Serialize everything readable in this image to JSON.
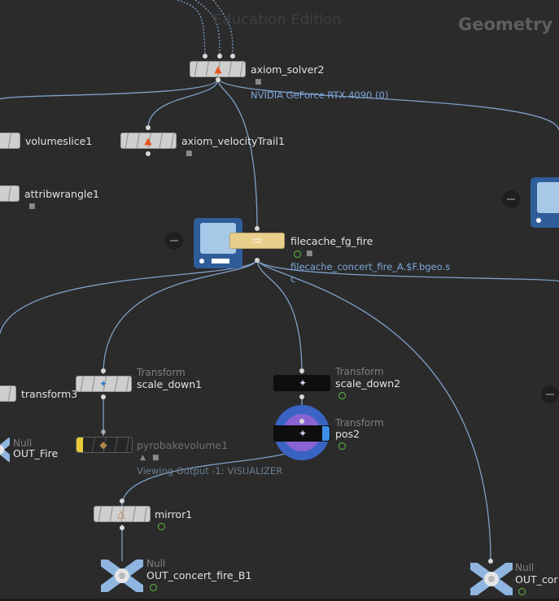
{
  "watermark": "Education Edition",
  "context_label": "Geometry",
  "nodes": {
    "axiom_solver2": {
      "label": "axiom_solver2",
      "info": "NVIDIA GeForce RTX 4090 (0)",
      "icon": "fire-icon"
    },
    "volumeslice1": {
      "label": "volumeslice1"
    },
    "axiom_velocityTrail1": {
      "label": "axiom_velocityTrail1",
      "icon": "fire-icon"
    },
    "attribwrangle1": {
      "label": "attribwrangle1"
    },
    "filecache_fg_fire": {
      "label": "filecache_fg_fire",
      "info_line1": "filecache_concert_fire_A.$F.bgeo.s",
      "info_line2": "c"
    },
    "transform3": {
      "label": "transform3"
    },
    "scale_down1": {
      "type": "Transform",
      "label": "scale_down1"
    },
    "scale_down2": {
      "type": "Transform",
      "label": "scale_down2"
    },
    "pos2": {
      "type": "Transform",
      "label": "pos2"
    },
    "OUT_Fire": {
      "type": "Null",
      "label": "OUT_Fire"
    },
    "pyrobakevolume1": {
      "label": "pyrobakevolume1",
      "warning": "Viewing Output -1: VISUALIZER"
    },
    "mirror1": {
      "label": "mirror1"
    },
    "OUT_concert_fire_B1": {
      "type": "Null",
      "label": "OUT_concert_fire_B1"
    },
    "OUT_right": {
      "type": "Null",
      "label": "OUT_cor"
    }
  },
  "colors": {
    "background": "#2b2b2b",
    "wire": "#7fa0c8",
    "node_gray": "#cfcfcf",
    "node_cache": "#e8cf8c",
    "display_flag": "#3a8ee6",
    "render_flag": "#8a63d2",
    "template_flag": "#e8c93a",
    "info_text": "#7fa7da"
  }
}
